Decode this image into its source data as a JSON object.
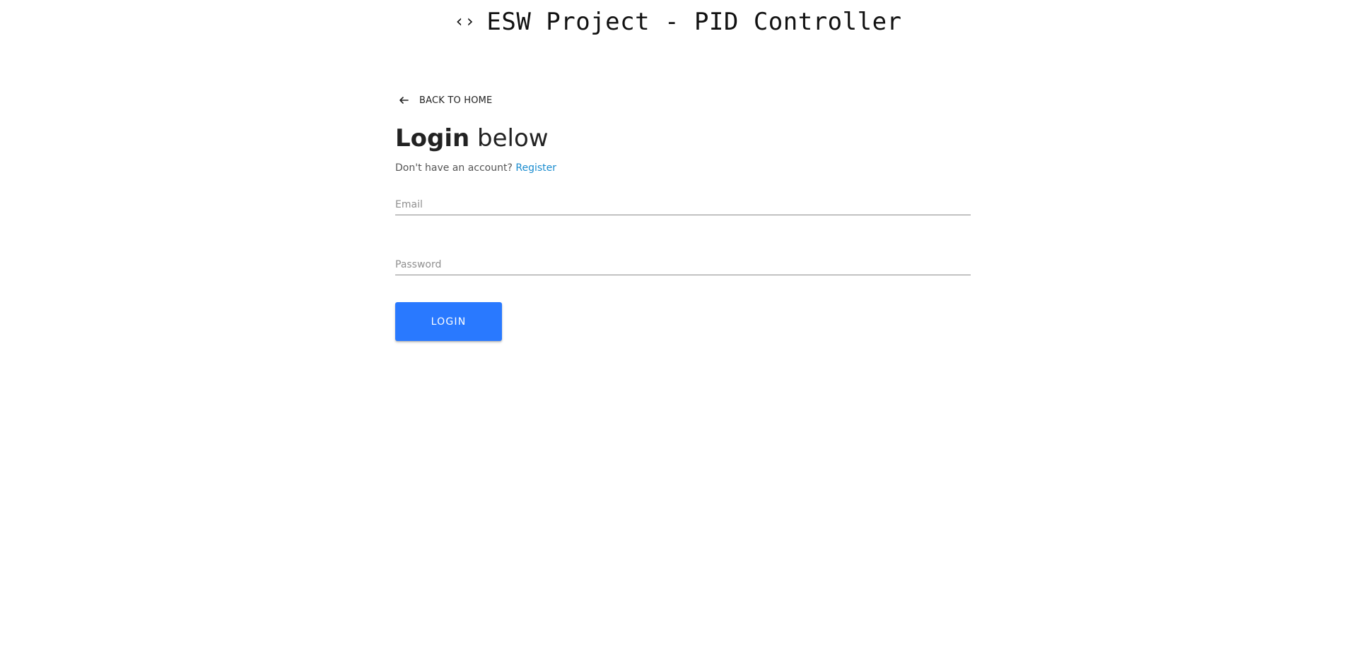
{
  "header": {
    "icon": "code-icon",
    "title": "ESW Project - PID Controller"
  },
  "back_link": {
    "icon": "arrow-left-icon",
    "label": "BACK TO HOME"
  },
  "login": {
    "title_bold": "Login",
    "title_rest": " below",
    "subtitle": "Don't have an account?",
    "register_label": "Register",
    "email_placeholder": "Email",
    "email_value": "",
    "password_placeholder": "Password",
    "password_value": "",
    "button_label": "LOGIN"
  },
  "colors": {
    "accent": "#2979ff",
    "link": "#1a8ccf",
    "underline": "#8a8a8a"
  }
}
